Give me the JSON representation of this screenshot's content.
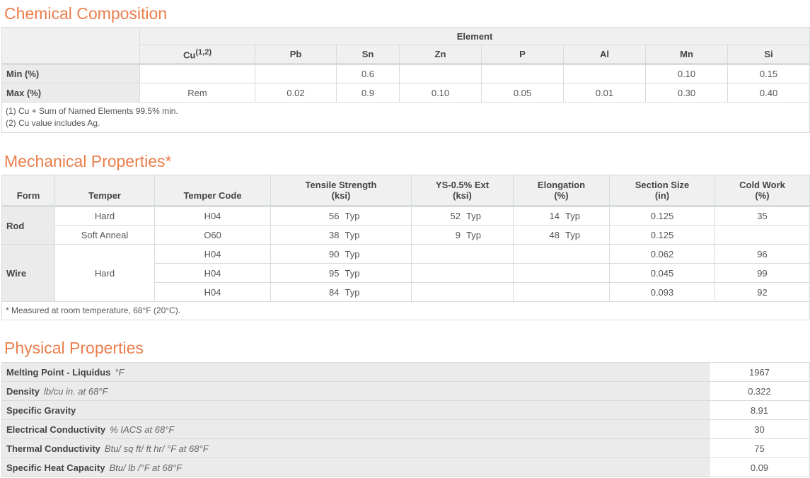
{
  "chemical": {
    "title": "Chemical Composition",
    "group_header": "Element",
    "elements": [
      "Cu",
      "Pb",
      "Sn",
      "Zn",
      "P",
      "Al",
      "Mn",
      "Si"
    ],
    "cu_sup": "(1,2)",
    "rows": [
      {
        "label": "Min (%)",
        "values": [
          "",
          "",
          "0.6",
          "",
          "",
          "",
          "0.10",
          "0.15"
        ]
      },
      {
        "label": "Max (%)",
        "values": [
          "Rem",
          "0.02",
          "0.9",
          "0.10",
          "0.05",
          "0.01",
          "0.30",
          "0.40"
        ]
      }
    ],
    "notes": [
      "(1) Cu + Sum of Named Elements 99.5% min.",
      "(2) Cu value includes Ag."
    ]
  },
  "mechanical": {
    "title": "Mechanical Properties*",
    "headers": {
      "form": "Form",
      "temper": "Temper",
      "temper_code": "Temper Code",
      "tensile_1": "Tensile Strength",
      "tensile_2": "(ksi)",
      "ys_1": "YS-0.5% Ext",
      "ys_2": "(ksi)",
      "elong_1": "Elongation",
      "elong_2": "(%)",
      "section_1": "Section Size",
      "section_2": "(in)",
      "cold_1": "Cold Work",
      "cold_2": "(%)"
    },
    "forms": {
      "rod": "Rod",
      "wire": "Wire"
    },
    "tempers": {
      "hard": "Hard",
      "soft": "Soft Anneal",
      "wire_hard": "Hard"
    },
    "typ": "Typ",
    "rows": [
      {
        "code": "H04",
        "tensile": "56",
        "ys": "52",
        "elong": "14",
        "section": "0.125",
        "cold": "35"
      },
      {
        "code": "O60",
        "tensile": "38",
        "ys": "9",
        "elong": "48",
        "section": "0.125",
        "cold": ""
      },
      {
        "code": "H04",
        "tensile": "90",
        "ys": "",
        "elong": "",
        "section": "0.062",
        "cold": "96"
      },
      {
        "code": "H04",
        "tensile": "95",
        "ys": "",
        "elong": "",
        "section": "0.045",
        "cold": "99"
      },
      {
        "code": "H04",
        "tensile": "84",
        "ys": "",
        "elong": "",
        "section": "0.093",
        "cold": "92"
      }
    ],
    "note": "* Measured at room temperature, 68°F (20°C)."
  },
  "physical": {
    "title": "Physical Properties",
    "rows": [
      {
        "label": "Melting Point - Liquidus",
        "unit": "°F",
        "value": "1967"
      },
      {
        "label": "Density",
        "unit": "lb/cu in. at 68°F",
        "value": "0.322"
      },
      {
        "label": "Specific Gravity",
        "unit": "",
        "value": "8.91"
      },
      {
        "label": "Electrical Conductivity",
        "unit": "% IACS at 68°F",
        "value": "30"
      },
      {
        "label": "Thermal Conductivity",
        "unit": "Btu/ sq ft/ ft hr/ °F at 68°F",
        "value": "75"
      },
      {
        "label": "Specific Heat Capacity",
        "unit": "Btu/ lb /°F at 68°F",
        "value": "0.09"
      }
    ]
  }
}
